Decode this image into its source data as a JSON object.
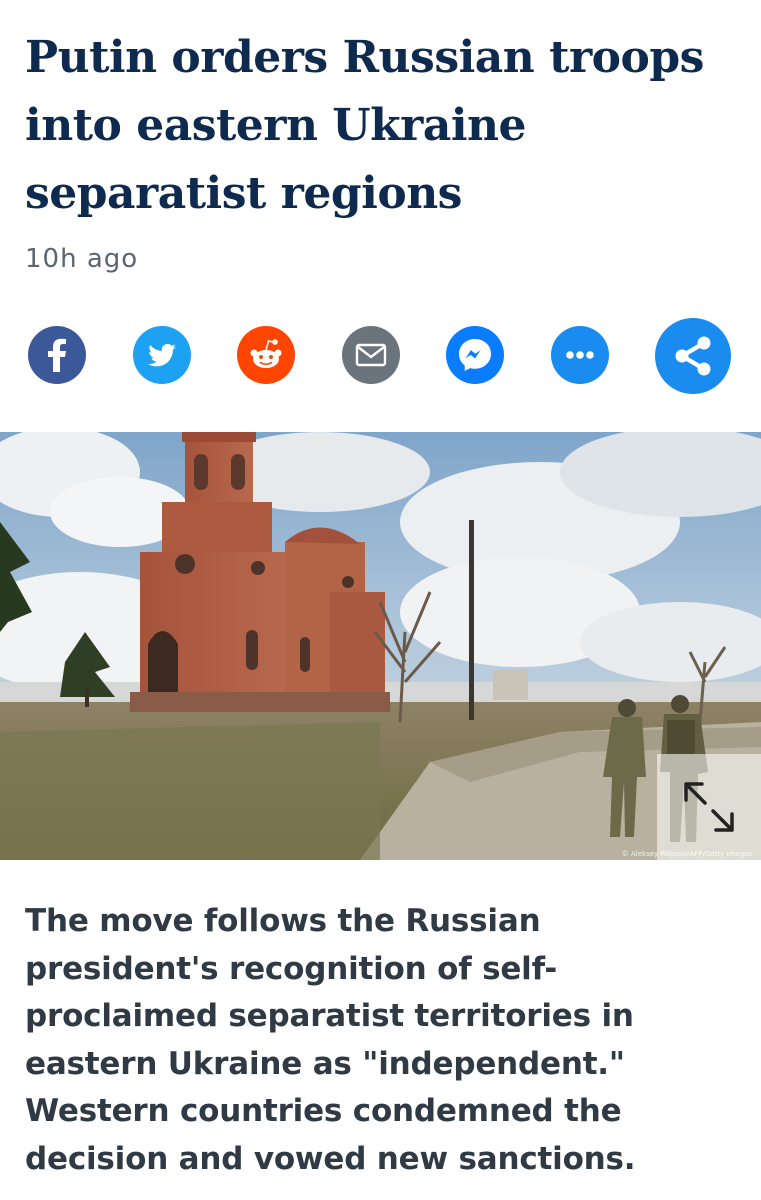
{
  "article": {
    "headline": "Putin orders Russian troops into eastern Ukraine separatist regions",
    "timestamp": "10h ago",
    "lead": "The move follows the Russian president's recognition of self-proclaimed separatist territories in eastern Ukraine as \"independent.\" Western countries condemned the decision and vowed new sanctions."
  },
  "share": {
    "buttons": [
      {
        "name": "facebook",
        "icon": "facebook-icon",
        "color": "#3b5998"
      },
      {
        "name": "twitter",
        "icon": "twitter-icon",
        "color": "#1da1f2"
      },
      {
        "name": "reddit",
        "icon": "reddit-icon",
        "color": "#ff4500"
      },
      {
        "name": "email",
        "icon": "mail-icon",
        "color": "#6b747c"
      },
      {
        "name": "messenger",
        "icon": "messenger-icon",
        "color": "#0a7cff"
      },
      {
        "name": "more",
        "icon": "more-icon",
        "color": "#1a8cf0"
      },
      {
        "name": "share",
        "icon": "share-icon",
        "color": "#1a8cf0"
      }
    ]
  },
  "hero_image": {
    "description_icon": "photo-ruined-church-soldiers",
    "credit": "© Aleksey Filippov/AFP/Getty Images",
    "expand_icon": "expand-icon"
  },
  "colors": {
    "headline": "#0e2a4e",
    "timestamp": "#5b6670",
    "body_text": "#2f3a45"
  }
}
